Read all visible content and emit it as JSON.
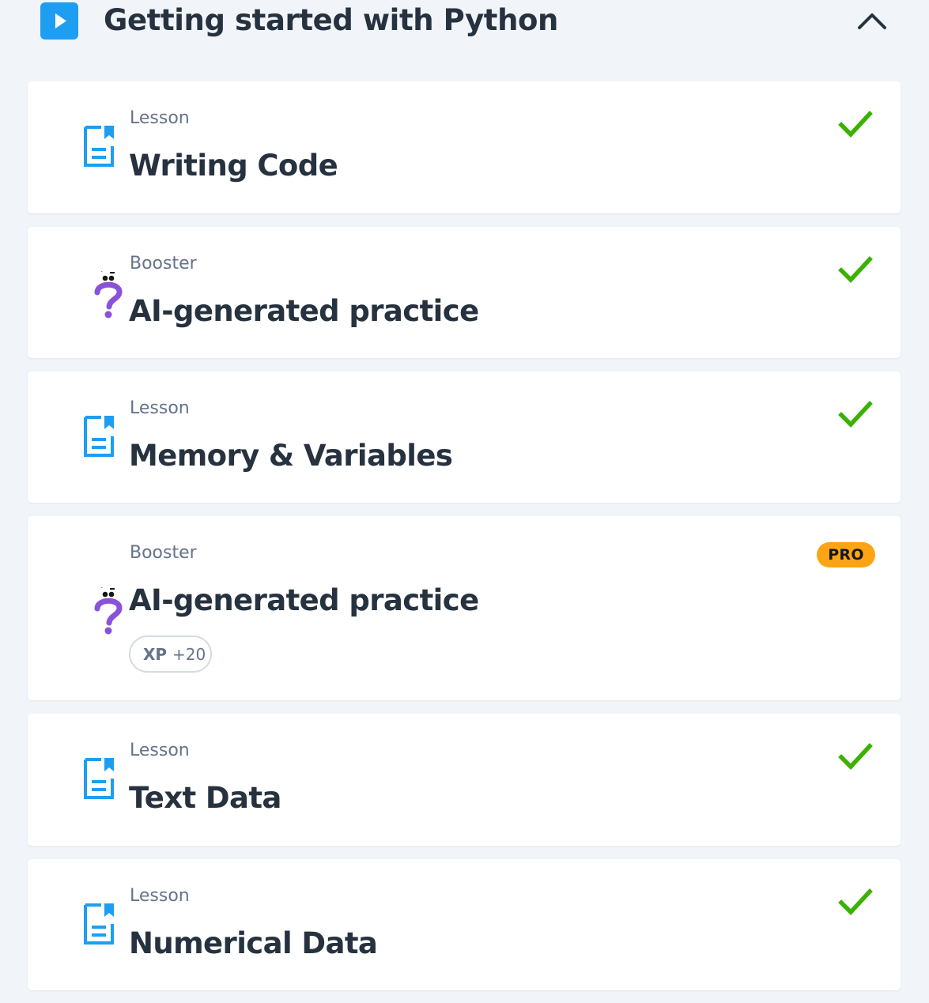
{
  "section": {
    "title": "Getting started with Python",
    "play_icon": "play-icon",
    "toggle_icon": "chevron-up-icon"
  },
  "colors": {
    "accent_blue": "#1e9ef3",
    "check_green": "#3bb100",
    "booster_purple": "#8a52d9",
    "pro_orange": "#fca514"
  },
  "items": [
    {
      "kind": "Lesson",
      "title": "Writing Code",
      "icon": "lesson-document-icon",
      "status": "completed",
      "status_icon": "check-icon"
    },
    {
      "kind": "Booster",
      "title": "AI-generated practice",
      "icon": "question-mark-character-icon",
      "status": "completed",
      "status_icon": "check-icon"
    },
    {
      "kind": "Lesson",
      "title": "Memory & Variables",
      "icon": "lesson-document-icon",
      "status": "completed",
      "status_icon": "check-icon"
    },
    {
      "kind": "Booster",
      "title": "AI-generated practice",
      "icon": "question-mark-character-icon",
      "status": "locked",
      "badge": "PRO",
      "xp_label": "XP",
      "xp_value": "+20"
    },
    {
      "kind": "Lesson",
      "title": "Text Data",
      "icon": "lesson-document-icon",
      "status": "completed",
      "status_icon": "check-icon"
    },
    {
      "kind": "Lesson",
      "title": "Numerical Data",
      "icon": "lesson-document-icon",
      "status": "completed",
      "status_icon": "check-icon"
    }
  ]
}
